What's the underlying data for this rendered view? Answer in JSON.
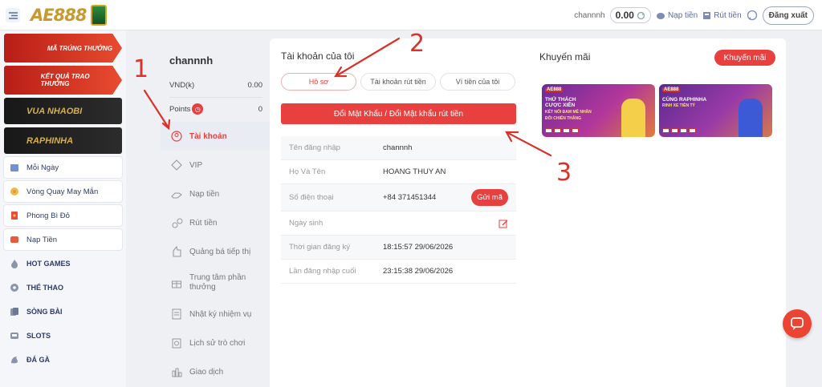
{
  "header": {
    "logo_text": "AE888",
    "username": "channnh",
    "balance": "0.00",
    "deposit_label": "Nạp tiền",
    "withdraw_label": "Rút tiền",
    "logout_label": "Đăng xuất"
  },
  "sidebar": {
    "banners": [
      {
        "label": "MÃ TRÚNG THƯỞNG"
      },
      {
        "label": "KẾT QUẢ TRAO THƯỞNG"
      },
      {
        "label": "VUA NHAOBI"
      },
      {
        "label": "RAPHINHA"
      }
    ],
    "items": [
      {
        "label": "Mỗi Ngày",
        "icon": "calendar-icon"
      },
      {
        "label": "Vòng Quay May Mắn",
        "icon": "wheel-icon"
      },
      {
        "label": "Phong Bì Đỏ",
        "icon": "envelope-icon"
      },
      {
        "label": "Nạp Tiền",
        "icon": "deposit-icon"
      },
      {
        "label": "HOT GAMES",
        "icon": "flame-icon"
      },
      {
        "label": "THỂ THAO",
        "icon": "ball-icon"
      },
      {
        "label": "SÒNG BÀI",
        "icon": "cards-icon"
      },
      {
        "label": "SLOTS",
        "icon": "slots-icon"
      },
      {
        "label": "ĐÁ GÀ",
        "icon": "rooster-icon"
      }
    ]
  },
  "account": {
    "username": "channnh",
    "vnd_label": "VND(k)",
    "vnd_value": "0.00",
    "points_label": "Points",
    "points_value": "0",
    "menu": [
      {
        "label": "Tài khoản",
        "icon": "user-icon"
      },
      {
        "label": "VIP",
        "icon": "vip-icon"
      },
      {
        "label": "Nạp tiền",
        "icon": "deposit-hand-icon"
      },
      {
        "label": "Rút tiền",
        "icon": "withdraw-icon"
      },
      {
        "label": "Quảng bá tiếp thị",
        "icon": "marketing-icon"
      },
      {
        "label": "Trung tâm phần thưởng",
        "icon": "gift-icon"
      },
      {
        "label": "Nhật ký nhiệm vụ",
        "icon": "task-log-icon"
      },
      {
        "label": "Lịch sử trò chơi",
        "icon": "history-icon"
      },
      {
        "label": "Giao dịch",
        "icon": "transactions-icon"
      }
    ]
  },
  "profile": {
    "title": "Tài khoản của tôi",
    "tabs": [
      "Hồ sơ",
      "Tài khoản rút tiền",
      "Ví tiền của tôi"
    ],
    "change_password_label": "Đổi Mật Khẩu / Đổi Mật khẩu rút tiền",
    "fields": [
      {
        "label": "Tên đăng nhập",
        "value": "channnh"
      },
      {
        "label": "Họ Và Tên",
        "value": "HOANG THUY AN"
      },
      {
        "label": "Số điện thoại",
        "value": "+84 371451344"
      },
      {
        "label": "Ngày sinh",
        "value": ""
      },
      {
        "label": "Thời gian đăng ký",
        "value": "18:15:57 29/06/2026"
      },
      {
        "label": "Lần đăng nhập cuối",
        "value": "23:15:38 29/06/2026"
      }
    ],
    "send_code_label": "Gửi mã"
  },
  "promotions": {
    "title": "Khuyến mãi",
    "button_label": "Khuyến mãi",
    "cards": [
      {
        "headline": "THỬ THÁCH CƯỢC XIÊN",
        "sub": "KẾT NỐI ĐAM MÊ NHÂN ĐÔI CHIẾN THẮNG"
      },
      {
        "headline": "CÙNG RAPHINHA",
        "sub": "RINH XE TIỀN TỶ"
      }
    ]
  },
  "annotations": [
    "1",
    "2",
    "3"
  ],
  "colors": {
    "accent": "#e8403f",
    "annotation": "#d9322b"
  }
}
